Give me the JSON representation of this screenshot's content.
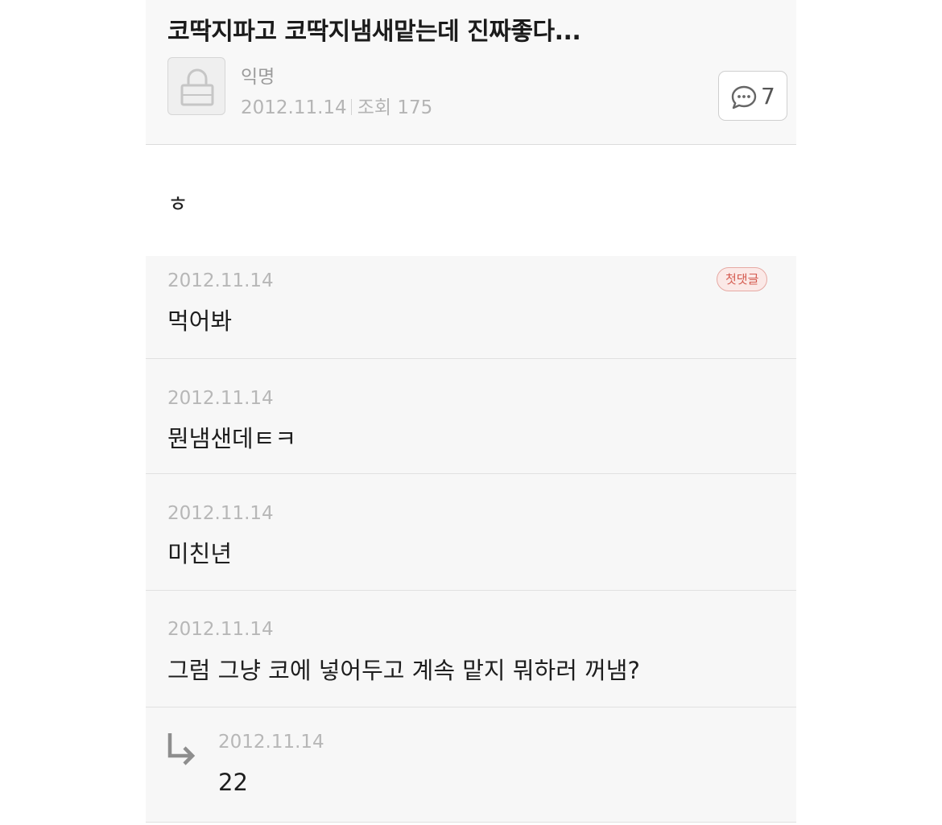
{
  "post": {
    "title": "코딱지파고 코딱지냄새맡는데 진짜좋다...",
    "author": "익명",
    "date": "2012.11.14",
    "views": "조회 175",
    "comment_count": "7",
    "body": "ㅎ"
  },
  "comments": [
    {
      "date": "2012.11.14",
      "text": "먹어봐",
      "badge": "첫댓글"
    },
    {
      "date": "2012.11.14",
      "text": "뭔냄샌데ㅌㅋ"
    },
    {
      "date": "2012.11.14",
      "text": "미친년"
    },
    {
      "date": "2012.11.14",
      "text": "그럼 그냥 코에 넣어두고 계속 맡지 뭐하러 꺼냄?"
    }
  ],
  "reply": {
    "date": "2012.11.14",
    "text": "22"
  },
  "colors": {
    "header_bg": "#f8f8f8",
    "comment_bg": "#f7f7f7",
    "badge_text": "#d45a4f",
    "badge_bg": "#fbe9e7"
  },
  "icons": {
    "avatar": "lock-icon",
    "comments": "speech-bubble-icon",
    "reply": "reply-arrow-icon"
  }
}
